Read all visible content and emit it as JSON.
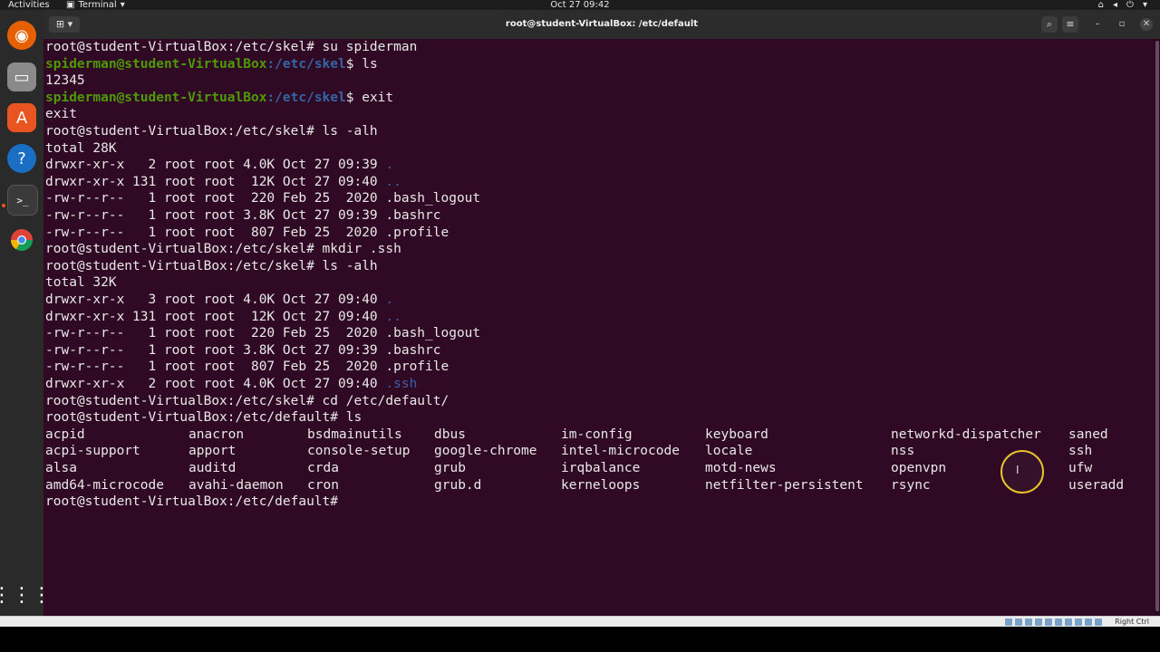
{
  "topbar": {
    "activities": "Activities",
    "app_name": "Terminal",
    "clock": "Oct 27  09:42"
  },
  "window": {
    "title": "root@student-VirtualBox: /etc/default"
  },
  "dock": {
    "items": [
      "firefox-icon",
      "files-icon",
      "software-icon",
      "help-icon",
      "terminal-icon",
      "chrome-icon"
    ],
    "show_apps": "apps-grid-icon"
  },
  "terminal": {
    "lines": [
      {
        "prompt_user": "",
        "plain": "root@student-VirtualBox:/etc/skel# su spiderman"
      },
      {
        "prompt_user": "spiderman@student-VirtualBox",
        "prompt_path": ":/etc/skel",
        "cmd": "$ ls"
      },
      {
        "plain": "12345"
      },
      {
        "prompt_user": "spiderman@student-VirtualBox",
        "prompt_path": ":/etc/skel",
        "cmd": "$ exit"
      },
      {
        "plain": "exit"
      },
      {
        "plain": "root@student-VirtualBox:/etc/skel# ls -alh"
      },
      {
        "plain": "total 28K"
      },
      {
        "plain": "drwxr-xr-x   2 root root 4.0K Oct 27 09:39 ",
        "dir": "."
      },
      {
        "plain": "drwxr-xr-x 131 root root  12K Oct 27 09:40 ",
        "dir": ".."
      },
      {
        "plain": "-rw-r--r--   1 root root  220 Feb 25  2020 .bash_logout"
      },
      {
        "plain": "-rw-r--r--   1 root root 3.8K Oct 27 09:39 .bashrc"
      },
      {
        "plain": "-rw-r--r--   1 root root  807 Feb 25  2020 .profile"
      },
      {
        "plain": "root@student-VirtualBox:/etc/skel# mkdir .ssh"
      },
      {
        "plain": "root@student-VirtualBox:/etc/skel# ls -alh"
      },
      {
        "plain": "total 32K"
      },
      {
        "plain": "drwxr-xr-x   3 root root 4.0K Oct 27 09:40 ",
        "dir": "."
      },
      {
        "plain": "drwxr-xr-x 131 root root  12K Oct 27 09:40 ",
        "dir": ".."
      },
      {
        "plain": "-rw-r--r--   1 root root  220 Feb 25  2020 .bash_logout"
      },
      {
        "plain": "-rw-r--r--   1 root root 3.8K Oct 27 09:39 .bashrc"
      },
      {
        "plain": "-rw-r--r--   1 root root  807 Feb 25  2020 .profile"
      },
      {
        "plain": "drwxr-xr-x   2 root root 4.0K Oct 27 09:40 ",
        "dir": ".ssh"
      },
      {
        "plain": "root@student-VirtualBox:/etc/skel# cd /etc/default/"
      },
      {
        "plain": "root@student-VirtualBox:/etc/default# ls"
      }
    ],
    "ls_columns": [
      [
        "acpid",
        "acpi-support",
        "alsa",
        "amd64-microcode"
      ],
      [
        "anacron",
        "apport",
        "auditd",
        "avahi-daemon"
      ],
      [
        "bsdmainutils",
        "console-setup",
        "crda",
        "cron"
      ],
      [
        "dbus",
        "google-chrome",
        "grub",
        "grub.d"
      ],
      [
        "im-config",
        "intel-microcode",
        "irqbalance",
        "kerneloops"
      ],
      [
        "keyboard",
        "locale",
        "motd-news",
        "netfilter-persistent"
      ],
      [
        "networkd-dispatcher",
        "nss",
        "openvpn",
        "rsync"
      ],
      [
        "saned",
        "ssh",
        "ufw",
        "useradd"
      ]
    ],
    "final_prompt": "root@student-VirtualBox:/etc/default# "
  },
  "statusbar": {
    "host_key": "Right Ctrl"
  }
}
